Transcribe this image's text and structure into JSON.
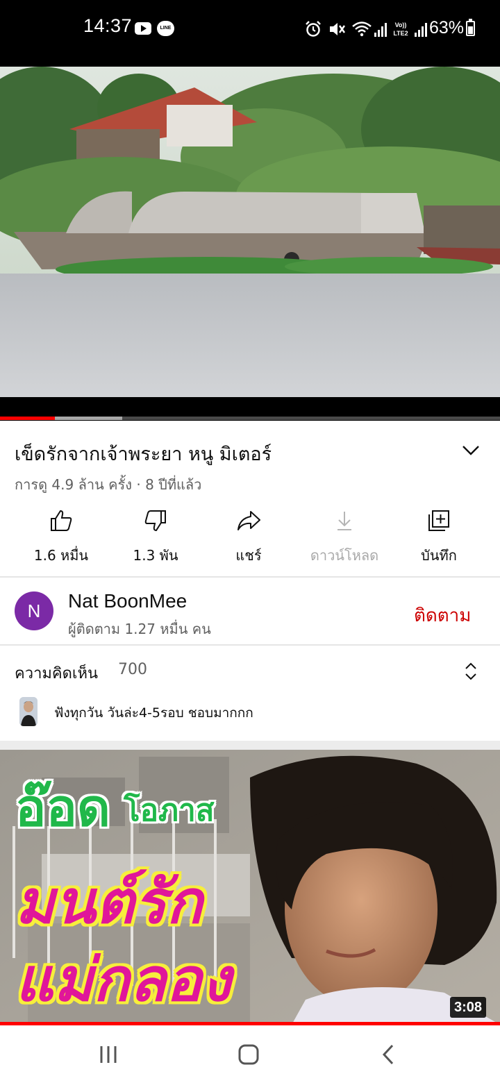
{
  "status_bar": {
    "time": "14:37",
    "line_badge": "LINE",
    "battery": "63%",
    "battery_level": 0.63,
    "icons": [
      "youtube-icon",
      "line-icon",
      "alarm-icon",
      "mute-icon",
      "wifi-icon",
      "signal-icon",
      "volte-icon",
      "signal-icon",
      "battery-icon"
    ]
  },
  "player": {
    "progress_played": 0.11,
    "progress_buffered": 0.245
  },
  "video": {
    "title": "เข็ดรักจากเจ้าพระยา หนู มิเตอร์",
    "meta": "การดู 4.9 ล้าน ครั้ง · 8 ปีที่แล้ว"
  },
  "actions": {
    "like": "1.6 หมื่น",
    "dislike": "1.3 พัน",
    "share": "แชร์",
    "download": "ดาวน์โหลด",
    "save": "บันทึก"
  },
  "channel": {
    "avatar_letter": "N",
    "name": "Nat BoonMee",
    "subscribers": "ผู้ติดตาม 1.27 หมื่น คน",
    "subscribe": "ติดตาม",
    "avatar_color": "#7b2aa6",
    "subscribe_color": "#cc0000"
  },
  "comments": {
    "title": "ความคิดเห็น",
    "count": "700",
    "top_comment": "ฟังทุกวัน วันล่ะ4-5รอบ ชอบมากกก"
  },
  "next_video": {
    "title_line1_big": "อ๊อด",
    "title_line1_small": "โอภาส",
    "title_line2": "มนต์รัก",
    "title_line3": "แม่กลอง",
    "duration": "3:08",
    "title_green": "#20b84a",
    "title_yellow": "#f7ee3c",
    "title_magenta": "#e0169a"
  },
  "nav": {
    "icons": [
      "recent-apps-icon",
      "home-icon",
      "back-icon"
    ]
  }
}
